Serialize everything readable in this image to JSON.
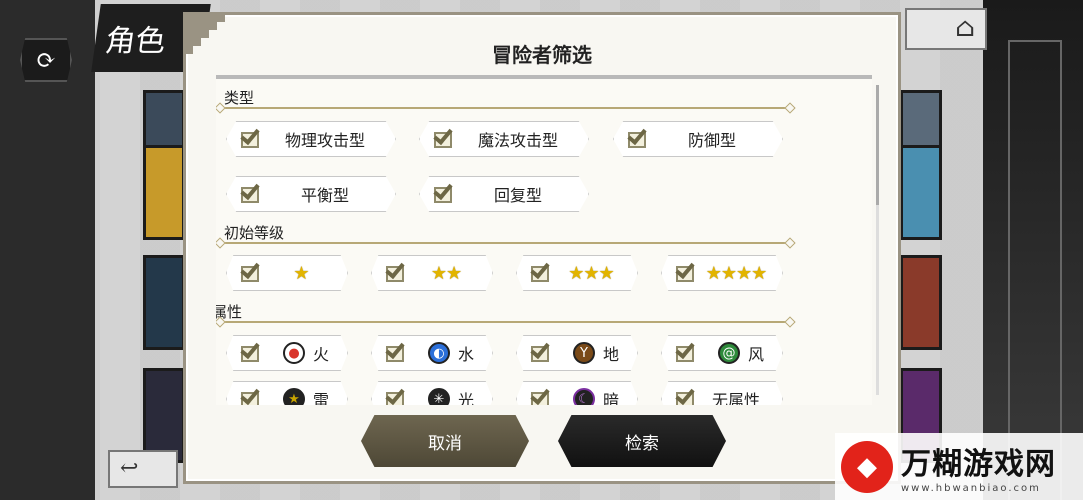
{
  "background": {
    "screen_title": "角色",
    "icons": [
      "refresh-icon",
      "home-icon",
      "back-icon"
    ]
  },
  "dialog": {
    "title": "冒险者筛选",
    "sections": {
      "type": {
        "label": "类型",
        "options": [
          "物理攻击型",
          "魔法攻击型",
          "防御型",
          "平衡型",
          "回复型"
        ]
      },
      "rarity": {
        "label": "初始等级",
        "options": [
          "★",
          "★★",
          "★★★",
          "★★★★"
        ]
      },
      "attribute": {
        "label": "属性",
        "options": [
          {
            "label": "火",
            "icon": "fire-icon",
            "color": "#d9342b"
          },
          {
            "label": "水",
            "icon": "water-icon",
            "color": "#2b6fd9"
          },
          {
            "label": "地",
            "icon": "earth-icon",
            "color": "#7a4a18"
          },
          {
            "label": "风",
            "icon": "wind-icon",
            "color": "#2d8a3a"
          },
          {
            "label": "雷",
            "icon": "thunder-icon",
            "color": "#c8a400"
          },
          {
            "label": "光",
            "icon": "light-icon",
            "color": "#222222"
          },
          {
            "label": "暗",
            "icon": "dark-icon",
            "color": "#7b2fa0"
          },
          {
            "label": "无属性",
            "icon": "none-icon",
            "color": ""
          }
        ]
      }
    },
    "buttons": {
      "cancel": "取消",
      "search": "检索"
    }
  },
  "watermark": {
    "title": "万糊游戏网",
    "url": "www.hbwanbiao.com"
  }
}
